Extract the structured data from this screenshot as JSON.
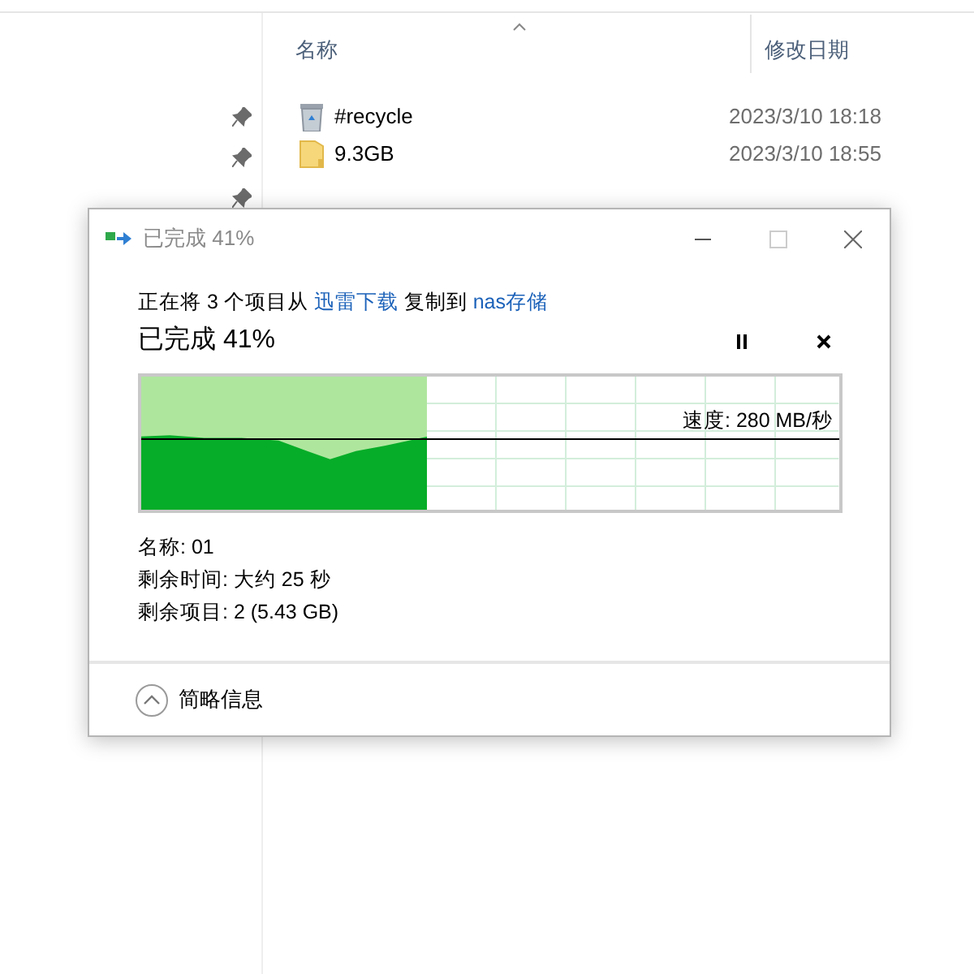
{
  "explorer": {
    "columns": [
      "名称",
      "修改日期"
    ],
    "files": [
      {
        "kind": "recycle",
        "name": "#recycle",
        "modified": "2023/3/10 18:18"
      },
      {
        "kind": "folder",
        "name": "9.3GB",
        "modified": "2023/3/10 18:55"
      }
    ]
  },
  "dialog": {
    "title": "已完成 41%",
    "copy_line": {
      "prefix": "正在将 3 个项目从",
      "source": "迅雷下载",
      "middle": "复制到",
      "destination": "nas存储"
    },
    "heading": "已完成 41%",
    "progress": {
      "level": 0.41,
      "speed": "速度: 280 MB/秒"
    },
    "details": [
      "名称: 01",
      "剩余时间: 大约 25 秒",
      "剩余项目: 2 (5.43 GB)"
    ],
    "toggle": {
      "label": "简略信息",
      "expanded": true
    }
  }
}
